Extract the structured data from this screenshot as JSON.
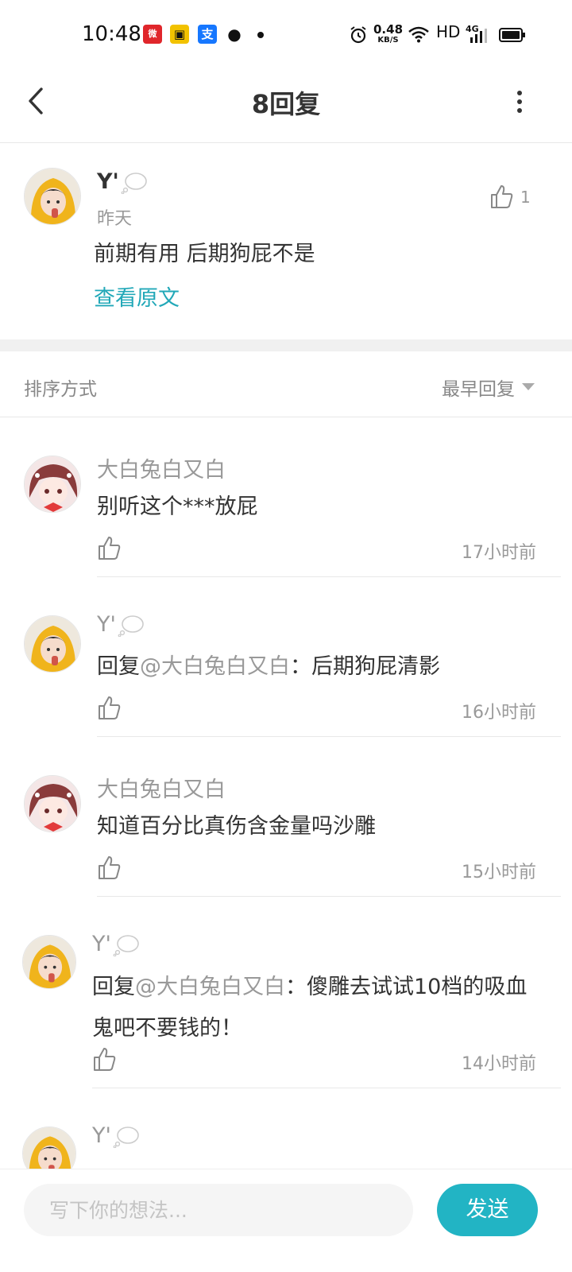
{
  "status_bar": {
    "time": "10:48",
    "speed_value": "0.48",
    "speed_unit": "KB/S",
    "hd": "HD",
    "network": "4G",
    "app_icons": [
      "weibo-icon",
      "bus-app-icon",
      "alipay-icon",
      "wechat-icon"
    ]
  },
  "header": {
    "title": "8回复"
  },
  "original": {
    "username": "Y'",
    "time": "昨天",
    "text": "前期有用 后期狗屁不是",
    "view_original": "查看原文",
    "like_count": "1"
  },
  "sort": {
    "label": "排序方式",
    "value": "最早回复"
  },
  "replies": [
    {
      "username": "大白兔白又白",
      "prefix": "",
      "mention": "",
      "text": "别听这个***放屁",
      "time": "17小时前",
      "avatar": "girl-pink"
    },
    {
      "username": "Y'",
      "prefix": "回复",
      "mention": "@大白兔白又白",
      "text": "：后期狗屁清影",
      "time": "16小时前",
      "avatar": "kid-yellow"
    },
    {
      "username": "大白兔白又白",
      "prefix": "",
      "mention": "",
      "text": "知道百分比真伤含金量吗沙雕",
      "time": "15小时前",
      "avatar": "girl-pink"
    },
    {
      "username": "Y'",
      "prefix": "回复",
      "mention": "@大白兔白又白",
      "text": "：傻雕去试试10档的吸血鬼吧不要钱的！",
      "time": "14小时前",
      "avatar": "kid-yellow"
    },
    {
      "username": "Y'",
      "prefix": "",
      "mention": "",
      "text": "",
      "time": "",
      "avatar": "kid-yellow"
    }
  ],
  "input": {
    "placeholder": "写下你的想法...",
    "value": ""
  },
  "send_label": "发送",
  "colors": {
    "accent": "#22b4c4",
    "link": "#22a8b8",
    "muted": "#999999"
  }
}
